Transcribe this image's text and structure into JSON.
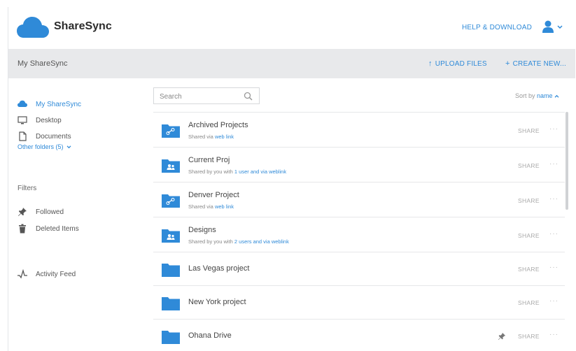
{
  "header": {
    "brand": "ShareSync",
    "help_link": "HELP & DOWNLOAD"
  },
  "toolbar": {
    "title": "My ShareSync",
    "upload_label": "UPLOAD FILES",
    "create_label": "CREATE NEW..."
  },
  "sidebar": {
    "items": [
      {
        "label": "My ShareSync",
        "icon": "cloud-icon"
      },
      {
        "label": "Desktop",
        "icon": "monitor-icon"
      },
      {
        "label": "Documents",
        "icon": "document-icon"
      }
    ],
    "other_folders": "Other folders (5)",
    "filters_label": "Filters",
    "filters": [
      {
        "label": "Followed",
        "icon": "pin-icon"
      },
      {
        "label": "Deleted Items",
        "icon": "trash-icon"
      }
    ],
    "activity": {
      "label": "Activity Feed",
      "icon": "activity-icon"
    }
  },
  "search": {
    "placeholder": "Search"
  },
  "sort": {
    "prefix": "Sort by",
    "field": "name"
  },
  "files": [
    {
      "name": "Archived Projects",
      "sub_prefix": "Shared via",
      "sub_link": "web link",
      "type": "link-folder",
      "share": "SHARE",
      "more": "···"
    },
    {
      "name": "Current Proj",
      "sub_prefix": "Shared by you with",
      "sub_link": "1 user and via weblink",
      "type": "shared-folder",
      "share": "SHARE",
      "more": "···"
    },
    {
      "name": "Denver Project",
      "sub_prefix": "Shared via",
      "sub_link": "web link",
      "type": "link-folder",
      "share": "SHARE",
      "more": "···"
    },
    {
      "name": "Designs",
      "sub_prefix": "Shared by you with",
      "sub_link": "2 users and via weblink",
      "type": "shared-folder",
      "share": "SHARE",
      "more": "···"
    },
    {
      "name": "Las Vegas project",
      "type": "folder",
      "share": "SHARE",
      "more": "···"
    },
    {
      "name": "New York project",
      "type": "folder",
      "share": "SHARE",
      "more": "···"
    },
    {
      "name": "Ohana Drive",
      "type": "folder",
      "followed": true,
      "share": "SHARE",
      "more": "···"
    }
  ],
  "colors": {
    "accent": "#2f8ad8",
    "toolbar_bg": "#e8e9eb",
    "folder": "#2f8ad8"
  }
}
